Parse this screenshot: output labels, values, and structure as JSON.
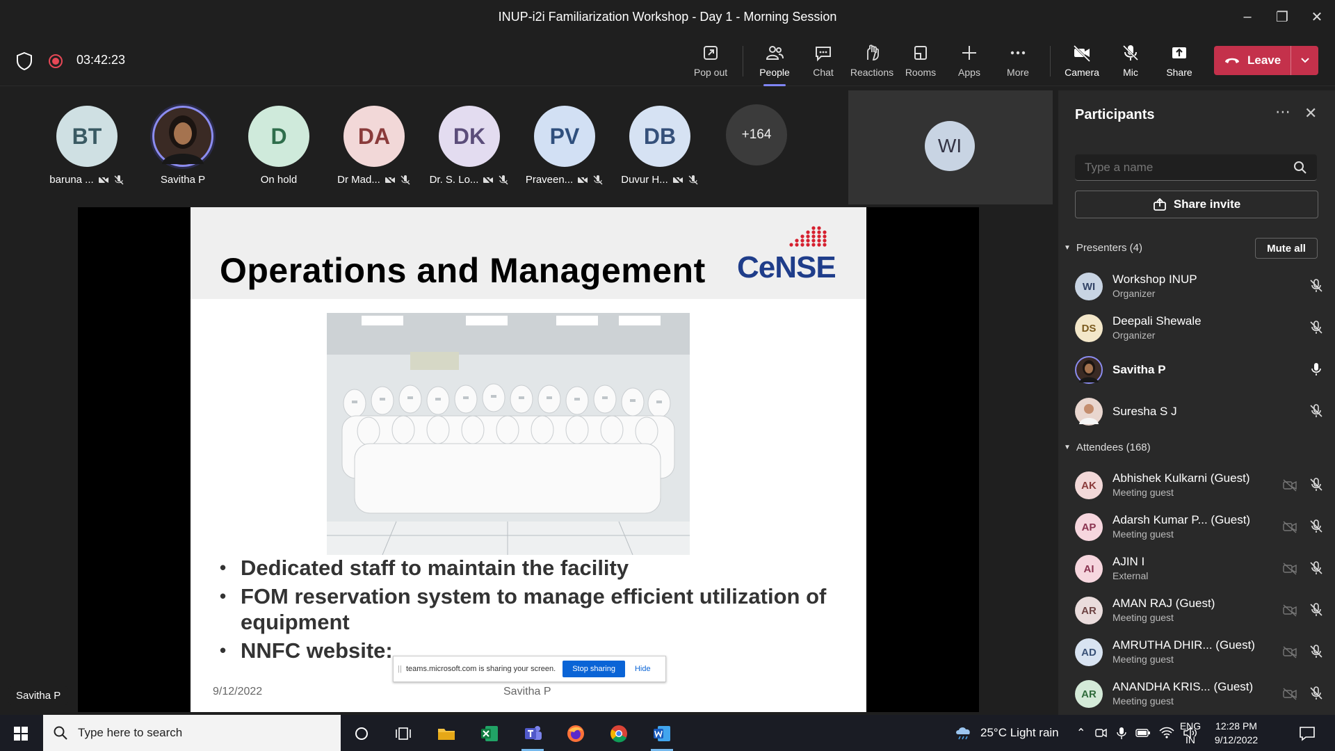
{
  "window": {
    "title": "INUP-i2i Familiarization Workshop - Day 1 - Morning Session"
  },
  "meeting": {
    "timer": "03:42:23"
  },
  "toolbar": {
    "pop_out": "Pop out",
    "people": "People",
    "chat": "Chat",
    "reactions": "Reactions",
    "rooms": "Rooms",
    "apps": "Apps",
    "more": "More",
    "camera": "Camera",
    "mic": "Mic",
    "share": "Share",
    "leave": "Leave"
  },
  "strip": {
    "tiles": [
      {
        "initials": "BT",
        "name": "baruna ...",
        "bg": "#cfe0e3",
        "fg": "#3a5a63"
      },
      {
        "initials": "",
        "name": "Savitha P",
        "bg": "#3a2a24",
        "fg": "#fff"
      },
      {
        "initials": "D",
        "name": "On hold",
        "bg": "#cfeadb",
        "fg": "#2f6e4c"
      },
      {
        "initials": "DA",
        "name": "Dr Mad...",
        "bg": "#f2d8d8",
        "fg": "#8a3b3b"
      },
      {
        "initials": "DK",
        "name": "Dr. S. Lo...",
        "bg": "#e3dcf0",
        "fg": "#5b4d7a"
      },
      {
        "initials": "PV",
        "name": "Praveen...",
        "bg": "#d2e0f4",
        "fg": "#2f4f7d"
      },
      {
        "initials": "DB",
        "name": "Duvur H...",
        "bg": "#d6e2f3",
        "fg": "#35507a"
      }
    ],
    "overflow": "+164",
    "featured_initials": "WI"
  },
  "slide": {
    "title": "Operations and Management",
    "logo_text": "CeNSE",
    "bullets": [
      "Dedicated staff to maintain the facility",
      "FOM reservation system to manage efficient utilization of equipment",
      "NNFC website:"
    ],
    "date": "9/12/2022",
    "presenter": "Savitha P"
  },
  "share_bar": {
    "message": "teams.microsoft.com is sharing your screen.",
    "stop": "Stop sharing",
    "hide": "Hide"
  },
  "stage_name_tag": "Savitha P",
  "panel": {
    "title": "Participants",
    "search_placeholder": "Type a name",
    "share_invite": "Share invite",
    "presenters_label": "Presenters (4)",
    "mute_all": "Mute all",
    "attendees_label": "Attendees (168)",
    "presenters": [
      {
        "initials": "WI",
        "name": "Workshop INUP",
        "role": "Organizer",
        "bg": "#c8d4e3",
        "fg": "#334466",
        "mic": "muted"
      },
      {
        "initials": "DS",
        "name": "Deepali Shewale",
        "role": "Organizer",
        "bg": "#f3e7c9",
        "fg": "#7a5a1e",
        "mic": "muted"
      },
      {
        "initials": "",
        "name": "Savitha P",
        "role": "",
        "bg": "#3a2a24",
        "fg": "#fff",
        "mic": "on"
      },
      {
        "initials": "",
        "name": "Suresha S J",
        "role": "",
        "bg": "#e9d6cf",
        "fg": "#fff",
        "mic": "muted"
      }
    ],
    "attendees": [
      {
        "initials": "AK",
        "name": "Abhishek Kulkarni (Guest)",
        "role": "Meeting guest",
        "bg": "#f2d8d8",
        "fg": "#8a3b3b"
      },
      {
        "initials": "AP",
        "name": "Adarsh Kumar P...  (Guest)",
        "role": "Meeting guest",
        "bg": "#f6d6de",
        "fg": "#8a3350"
      },
      {
        "initials": "AI",
        "name": "AJIN I",
        "role": "External",
        "bg": "#f6d6de",
        "fg": "#8a3350"
      },
      {
        "initials": "AR",
        "name": "AMAN RAJ (Guest)",
        "role": "Meeting guest",
        "bg": "#eadcdc",
        "fg": "#6d4343"
      },
      {
        "initials": "AD",
        "name": "AMRUTHA DHIR...  (Guest)",
        "role": "Meeting guest",
        "bg": "#d8e3f1",
        "fg": "#3a5277"
      },
      {
        "initials": "AR",
        "name": "ANANDHA KRIS...  (Guest)",
        "role": "Meeting guest",
        "bg": "#d4ead8",
        "fg": "#2f6b3b"
      }
    ]
  },
  "taskbar": {
    "search_placeholder": "Type here to search",
    "weather": "25°C  Light rain",
    "lang_1": "ENG",
    "lang_2": "IN",
    "time": "12:28 PM",
    "date": "9/12/2022"
  }
}
